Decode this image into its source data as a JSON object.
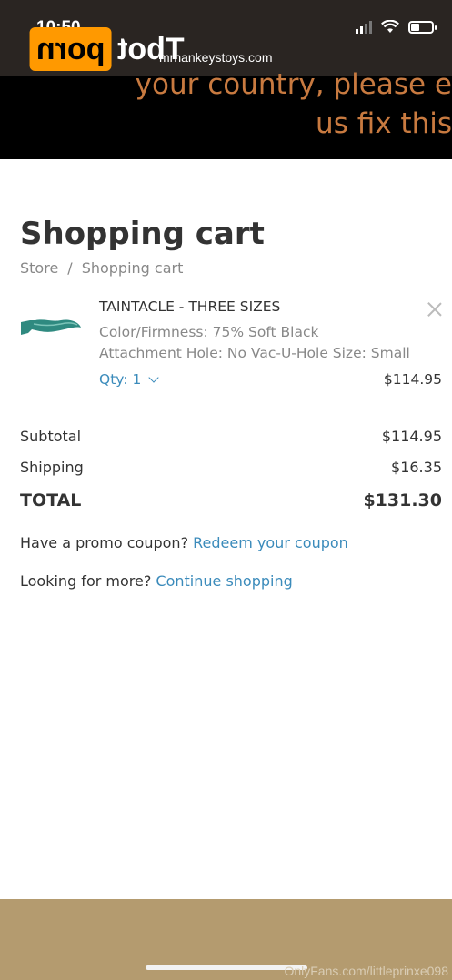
{
  "status_bar": {
    "time": "10:50"
  },
  "watermark": {
    "logo_box": "porn",
    "logo_text": "Tbot",
    "footer": "OnlyFans.com/littleprinxe098"
  },
  "browser": {
    "url": "mrhankeystoys.com"
  },
  "banner": {
    "line1": "your country, please e",
    "line2": "us fix this"
  },
  "page": {
    "title": "Shopping cart",
    "breadcrumb": [
      "Store",
      "/",
      "Shopping cart"
    ]
  },
  "cart_item": {
    "name": "TAINTACLE - THREE SIZES",
    "option1": "Color/Firmness: 75% Soft Black",
    "option2": "Attachment Hole: No Vac-U-Hole  Size: Small",
    "qty_label": "Qty: 1",
    "price": "$114.95",
    "thumb_color": "#2f8a80"
  },
  "summary": {
    "subtotal_label": "Subtotal",
    "subtotal_value": "$114.95",
    "shipping_label": "Shipping",
    "shipping_value": "$16.35",
    "total_label": "TOTAL",
    "total_value": "$131.30"
  },
  "promo": {
    "text": "Have a promo coupon?",
    "link": "Redeem your coupon"
  },
  "more": {
    "text": "Looking for more?",
    "link": "Continue shopping"
  },
  "colors": {
    "link": "#3b8bbb",
    "banner_text": "#c87a40",
    "footer_band": "#b49b6f"
  }
}
